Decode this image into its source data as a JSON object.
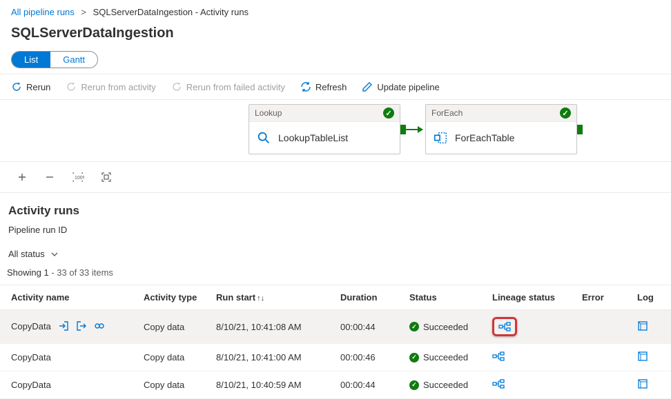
{
  "breadcrumb": {
    "root": "All pipeline runs",
    "current": "SQLServerDataIngestion - Activity runs"
  },
  "page_title": "SQLServerDataIngestion",
  "tabs": {
    "list": "List",
    "gantt": "Gantt"
  },
  "toolbar": {
    "rerun": "Rerun",
    "rerun_activity": "Rerun from activity",
    "rerun_failed": "Rerun from failed activity",
    "refresh": "Refresh",
    "update": "Update pipeline"
  },
  "activities": {
    "lookup": {
      "type": "Lookup",
      "name": "LookupTableList"
    },
    "foreach": {
      "type": "ForEach",
      "name": "ForEachTable"
    }
  },
  "section_title": "Activity runs",
  "sub_label": "Pipeline run ID",
  "filter_label": "All status",
  "count_prefix": "Showing 1",
  "count_suffix": " - 33 of 33 items",
  "columns": {
    "name": "Activity name",
    "type": "Activity type",
    "start": "Run start",
    "duration": "Duration",
    "status": "Status",
    "lineage": "Lineage status",
    "error": "Error",
    "log": "Log"
  },
  "rows": [
    {
      "name": "CopyData",
      "type": "Copy data",
      "start": "8/10/21, 10:41:08 AM",
      "duration": "00:00:44",
      "status": "Succeeded",
      "hover": true,
      "highlight": true
    },
    {
      "name": "CopyData",
      "type": "Copy data",
      "start": "8/10/21, 10:41:00 AM",
      "duration": "00:00:46",
      "status": "Succeeded",
      "hover": false,
      "highlight": false
    },
    {
      "name": "CopyData",
      "type": "Copy data",
      "start": "8/10/21, 10:40:59 AM",
      "duration": "00:00:44",
      "status": "Succeeded",
      "hover": false,
      "highlight": false
    }
  ]
}
